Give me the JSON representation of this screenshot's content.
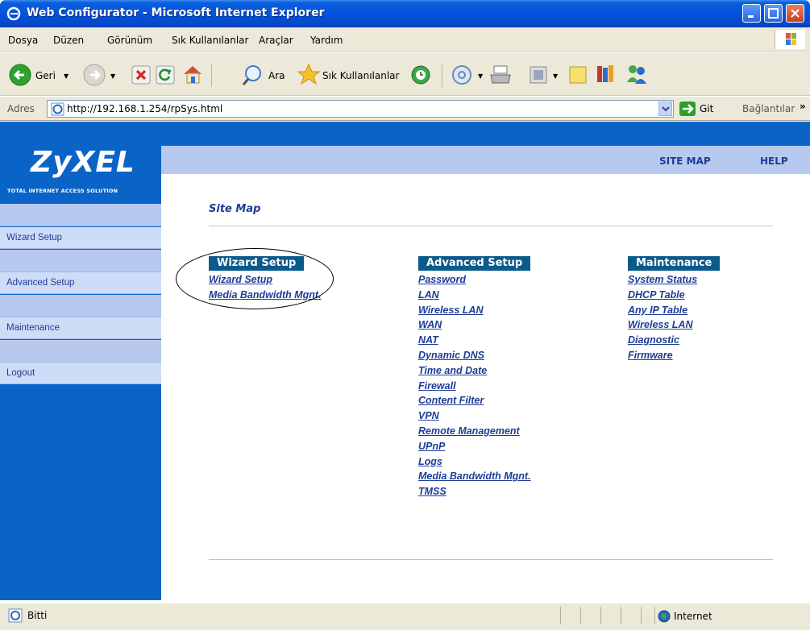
{
  "window": {
    "title": "Web Configurator - Microsoft Internet Explorer"
  },
  "menu": {
    "items": [
      "Dosya",
      "Düzen",
      "Görünüm",
      "Sık Kullanılanlar",
      "Araçlar",
      "Yardım"
    ]
  },
  "toolbar": {
    "back_label": "Geri",
    "search_label": "Ara",
    "favorites_label": "Sık Kullanılanlar"
  },
  "address": {
    "label": "Adres",
    "url": "http://192.168.1.254/rpSys.html",
    "go_label": "Git",
    "links_label": "Bağlantılar"
  },
  "header": {
    "brand": "ZyXEL",
    "tagline": "TOTAL INTERNET ACCESS SOLUTION",
    "site_map_link": "SITE MAP",
    "help_link": "HELP"
  },
  "sidebar": {
    "items": [
      "Wizard Setup",
      "Advanced Setup",
      "Maintenance",
      "Logout"
    ]
  },
  "main": {
    "title": "Site Map",
    "columns": [
      {
        "heading": "Wizard Setup",
        "links": [
          "Wizard Setup",
          "Media Bandwidth Mgnt."
        ]
      },
      {
        "heading": "Advanced Setup",
        "links": [
          "Password",
          "LAN",
          "Wireless LAN",
          "WAN",
          "NAT",
          "Dynamic DNS",
          "Time and Date",
          "Firewall",
          "Content Filter",
          "VPN",
          "Remote Management",
          "UPnP",
          "Logs",
          "Media Bandwidth Mgnt.",
          "TMSS"
        ]
      },
      {
        "heading": "Maintenance",
        "links": [
          "System Status",
          "DHCP Table",
          "Any IP Table",
          "Wireless LAN",
          "Diagnostic",
          "Firmware"
        ]
      }
    ]
  },
  "status": {
    "text": "Bitti",
    "zone": "Internet"
  },
  "colors": {
    "brand_blue": "#0a64c8",
    "nav_light": "#b8c9f0",
    "link": "#1e3c96",
    "heading_bg": "#0a5a8c"
  }
}
